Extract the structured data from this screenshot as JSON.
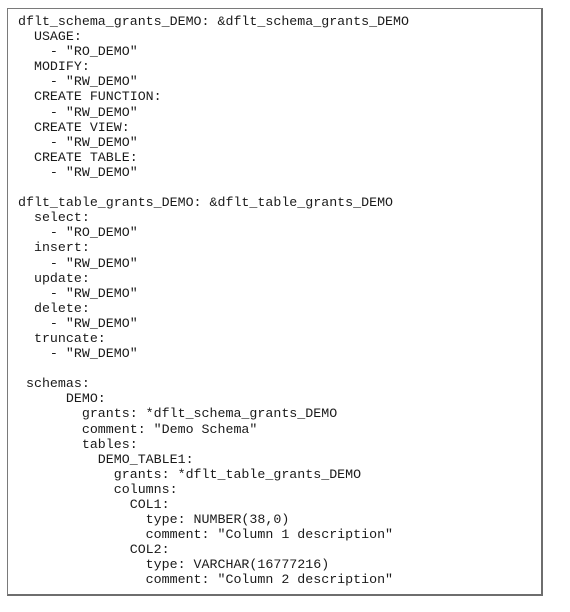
{
  "document": {
    "type": "yaml-code-listing",
    "lines": [
      "dflt_schema_grants_DEMO: &dflt_schema_grants_DEMO",
      "  USAGE:",
      "    - \"RO_DEMO\"",
      "  MODIFY:",
      "    - \"RW_DEMO\"",
      "  CREATE FUNCTION:",
      "    - \"RW_DEMO\"",
      "  CREATE VIEW:",
      "    - \"RW_DEMO\"",
      "  CREATE TABLE:",
      "    - \"RW_DEMO\"",
      "",
      "dflt_table_grants_DEMO: &dflt_table_grants_DEMO",
      "  select:",
      "    - \"RO_DEMO\"",
      "  insert:",
      "    - \"RW_DEMO\"",
      "  update:",
      "    - \"RW_DEMO\"",
      "  delete:",
      "    - \"RW_DEMO\"",
      "  truncate:",
      "    - \"RW_DEMO\"",
      "",
      " schemas:",
      "      DEMO:",
      "        grants: *dflt_schema_grants_DEMO",
      "        comment: \"Demo Schema\"",
      "        tables:",
      "          DEMO_TABLE1:",
      "            grants: *dflt_table_grants_DEMO",
      "            columns:",
      "              COL1:",
      "                type: NUMBER(38,0)",
      "                comment: \"Column 1 description\"",
      "              COL2:",
      "                type: VARCHAR(16777216)",
      "                comment: \"Column 2 description\""
    ]
  }
}
